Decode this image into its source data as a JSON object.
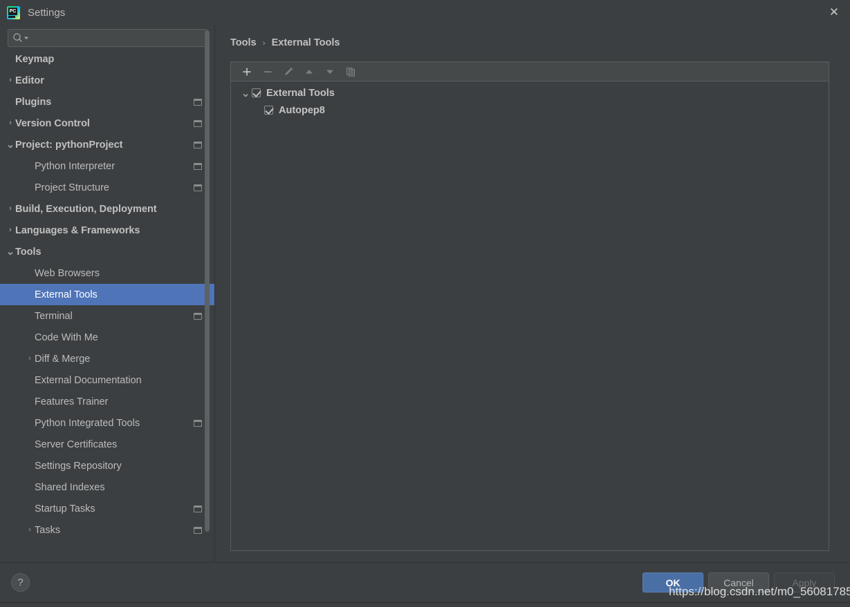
{
  "window": {
    "title": "Settings",
    "logo_icon": "pycharm-logo",
    "close_icon": "close-icon"
  },
  "search": {
    "placeholder": "",
    "value": "",
    "icon": "search-icon",
    "dropdown_icon": "chevron-down-icon"
  },
  "sidebar": {
    "scrollbar": "vertical-scrollbar",
    "items": [
      {
        "label": "",
        "level": 0,
        "arrow": "",
        "badge": false,
        "partial": true,
        "selected": false
      },
      {
        "label": "Keymap",
        "level": 0,
        "arrow": "",
        "badge": false,
        "bold": true,
        "selected": false
      },
      {
        "label": "Editor",
        "level": 0,
        "arrow": "collapsed",
        "badge": false,
        "bold": true,
        "selected": false
      },
      {
        "label": "Plugins",
        "level": 0,
        "arrow": "",
        "badge": true,
        "bold": true,
        "selected": false
      },
      {
        "label": "Version Control",
        "level": 0,
        "arrow": "collapsed",
        "badge": true,
        "bold": true,
        "selected": false
      },
      {
        "label": "Project: pythonProject",
        "level": 0,
        "arrow": "expanded",
        "badge": true,
        "bold": true,
        "selected": false
      },
      {
        "label": "Python Interpreter",
        "level": 1,
        "arrow": "",
        "badge": true,
        "bold": false,
        "selected": false
      },
      {
        "label": "Project Structure",
        "level": 1,
        "arrow": "",
        "badge": true,
        "bold": false,
        "selected": false
      },
      {
        "label": "Build, Execution, Deployment",
        "level": 0,
        "arrow": "collapsed",
        "badge": false,
        "bold": true,
        "selected": false
      },
      {
        "label": "Languages & Frameworks",
        "level": 0,
        "arrow": "collapsed",
        "badge": false,
        "bold": true,
        "selected": false
      },
      {
        "label": "Tools",
        "level": 0,
        "arrow": "expanded",
        "badge": false,
        "bold": true,
        "selected": false
      },
      {
        "label": "Web Browsers",
        "level": 1,
        "arrow": "",
        "badge": false,
        "bold": false,
        "selected": false
      },
      {
        "label": "External Tools",
        "level": 1,
        "arrow": "",
        "badge": false,
        "bold": false,
        "selected": true
      },
      {
        "label": "Terminal",
        "level": 1,
        "arrow": "",
        "badge": true,
        "bold": false,
        "selected": false
      },
      {
        "label": "Code With Me",
        "level": 1,
        "arrow": "",
        "badge": false,
        "bold": false,
        "selected": false
      },
      {
        "label": "Diff & Merge",
        "level": 1,
        "arrow": "collapsed",
        "badge": false,
        "bold": false,
        "selected": false
      },
      {
        "label": "External Documentation",
        "level": 1,
        "arrow": "",
        "badge": false,
        "bold": false,
        "selected": false
      },
      {
        "label": "Features Trainer",
        "level": 1,
        "arrow": "",
        "badge": false,
        "bold": false,
        "selected": false
      },
      {
        "label": "Python Integrated Tools",
        "level": 1,
        "arrow": "",
        "badge": true,
        "bold": false,
        "selected": false
      },
      {
        "label": "Server Certificates",
        "level": 1,
        "arrow": "",
        "badge": false,
        "bold": false,
        "selected": false
      },
      {
        "label": "Settings Repository",
        "level": 1,
        "arrow": "",
        "badge": false,
        "bold": false,
        "selected": false
      },
      {
        "label": "Shared Indexes",
        "level": 1,
        "arrow": "",
        "badge": false,
        "bold": false,
        "selected": false
      },
      {
        "label": "Startup Tasks",
        "level": 1,
        "arrow": "",
        "badge": true,
        "bold": false,
        "selected": false
      },
      {
        "label": "Tasks",
        "level": 1,
        "arrow": "collapsed",
        "badge": true,
        "bold": false,
        "selected": false
      }
    ]
  },
  "breadcrumb": {
    "parent": "Tools",
    "separator": "›",
    "current": "External Tools"
  },
  "toolbar": {
    "buttons": [
      {
        "name": "add-button",
        "icon": "plus-icon",
        "enabled": true
      },
      {
        "name": "remove-button",
        "icon": "minus-icon",
        "enabled": false
      },
      {
        "name": "edit-button",
        "icon": "pencil-icon",
        "enabled": false
      },
      {
        "name": "move-up-button",
        "icon": "arrow-up-icon",
        "enabled": false
      },
      {
        "name": "move-down-button",
        "icon": "arrow-down-icon",
        "enabled": false
      },
      {
        "name": "copy-button",
        "icon": "copy-icon",
        "enabled": false
      }
    ]
  },
  "external_tools_tree": [
    {
      "label": "External Tools",
      "level": 0,
      "arrow": "expanded",
      "checked": true
    },
    {
      "label": "Autopep8",
      "level": 1,
      "arrow": "",
      "checked": true
    }
  ],
  "footer": {
    "help_label": "?",
    "help_icon": "question-mark-icon",
    "ok_label": "OK",
    "cancel_label": "Cancel",
    "apply_label": "Apply"
  },
  "watermark": {
    "text": "https://blog.csdn.net/m0_56081785"
  },
  "colors": {
    "bg": "#3c3f41",
    "selection": "#4f74b8",
    "text": "#bbbbbb",
    "accent_ok": "#4a6fa5",
    "border": "#5a5d5e"
  }
}
